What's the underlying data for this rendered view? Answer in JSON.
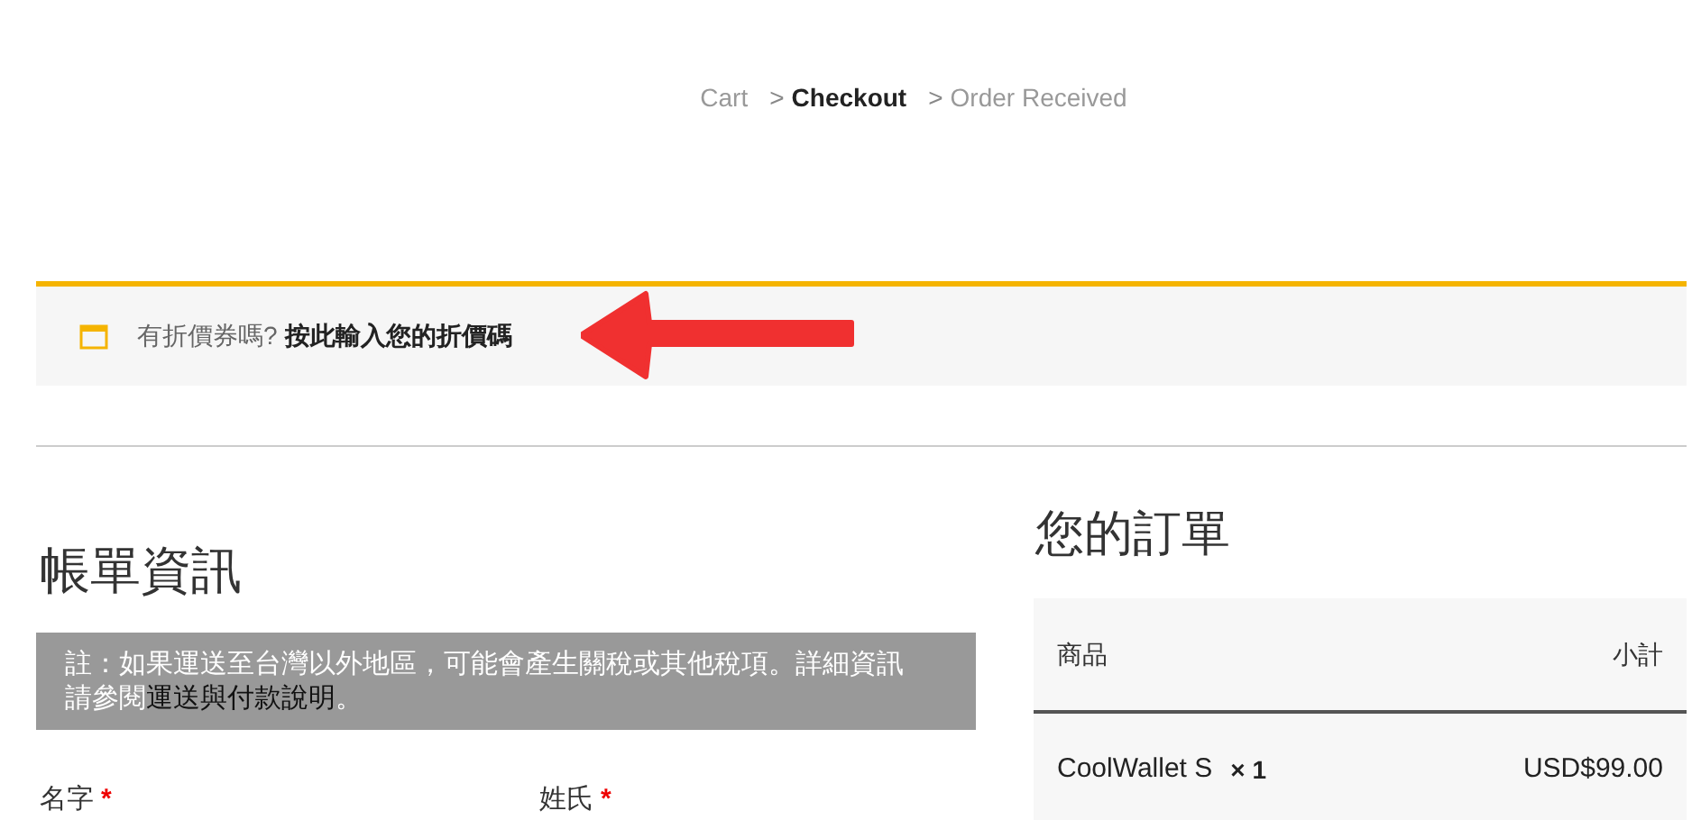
{
  "breadcrumb": [
    {
      "label": "Cart",
      "selected": false
    },
    {
      "label": "Checkout",
      "selected": true
    },
    {
      "label": "Order Received",
      "selected": false
    }
  ],
  "breadcrumb_separator": ">",
  "coupon_notice": {
    "text": "有折價券嗎?",
    "link": "按此輸入您的折價碼"
  },
  "billing": {
    "title": "帳單資訊",
    "note": {
      "text": "註：如果運送至台灣以外地區，可能會產生關稅或其他稅項。詳細資訊請參閱",
      "link": "運送與付款說明",
      "end": "。"
    },
    "fields": [
      {
        "label": "名字",
        "required": true,
        "required_mark": "*"
      },
      {
        "label": "姓氏",
        "required": true,
        "required_mark": "*"
      }
    ]
  },
  "order": {
    "title": "您的訂單",
    "columns": [
      "商品",
      "小計"
    ],
    "rows": [
      {
        "product": "CoolWallet S",
        "quantity": "× 1",
        "subtotal": "USD$99.00"
      }
    ]
  }
}
